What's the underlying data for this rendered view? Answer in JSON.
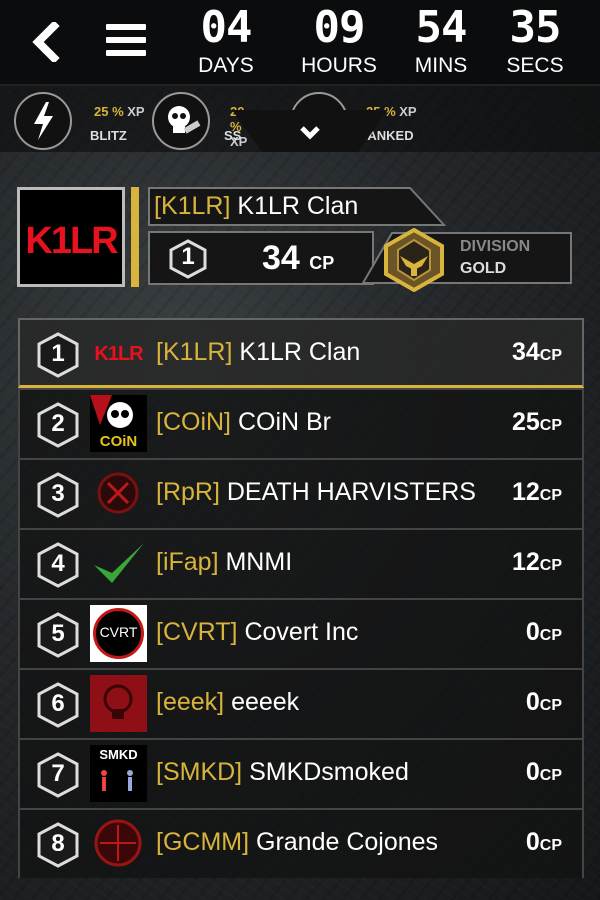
{
  "countdown": [
    {
      "value": "04",
      "label": "DAYS"
    },
    {
      "value": "09",
      "label": "HOURS"
    },
    {
      "value": "54",
      "label": "MINS"
    },
    {
      "value": "35",
      "label": "SECS"
    }
  ],
  "modes": [
    {
      "xp": "25 %",
      "xp_unit": "XP",
      "name": "BLITZ",
      "icon": "lightning-icon"
    },
    {
      "xp": "20 %",
      "xp_unit": "XP",
      "name": "SS",
      "icon": "skull-icon"
    },
    {
      "xp": "25 %",
      "xp_unit": "XP",
      "name": "RANKED",
      "icon": "ranked-icon"
    }
  ],
  "clan": {
    "logo_text": "K1LR",
    "tag": "[K1LR]",
    "name": "K1LR Clan",
    "rank": "1",
    "score": "34",
    "score_unit": "CP",
    "division_label": "DIVISION",
    "division_value": "GOLD"
  },
  "colors": {
    "accent": "#d8b43c",
    "logo_red": "#e8121e"
  },
  "leaderboard": [
    {
      "rank": "1",
      "tag": "[K1LR]",
      "name": "K1LR Clan",
      "score": "34",
      "unit": "CP",
      "avatar_text": "K1LR"
    },
    {
      "rank": "2",
      "tag": "[COiN]",
      "name": "COiN Br",
      "score": "25",
      "unit": "CP",
      "avatar_text": "COiN"
    },
    {
      "rank": "3",
      "tag": "[RpR]",
      "name": "DEATH HARVISTERS",
      "score": "12",
      "unit": "CP",
      "avatar_text": ""
    },
    {
      "rank": "4",
      "tag": "[iFap]",
      "name": "MNMI",
      "score": "12",
      "unit": "CP",
      "avatar_text": ""
    },
    {
      "rank": "5",
      "tag": "[CVRT]",
      "name": "Covert Inc",
      "score": "0",
      "unit": "CP",
      "avatar_text": "CVRT"
    },
    {
      "rank": "6",
      "tag": "[eeek]",
      "name": "eeeek",
      "score": "0",
      "unit": "CP",
      "avatar_text": ""
    },
    {
      "rank": "7",
      "tag": "[SMKD]",
      "name": "SMKDsmoked",
      "score": "0",
      "unit": "CP",
      "avatar_text": "SMKD"
    },
    {
      "rank": "8",
      "tag": "[GCMM]",
      "name": "Grande Cojones",
      "score": "0",
      "unit": "CP",
      "avatar_text": ""
    }
  ]
}
